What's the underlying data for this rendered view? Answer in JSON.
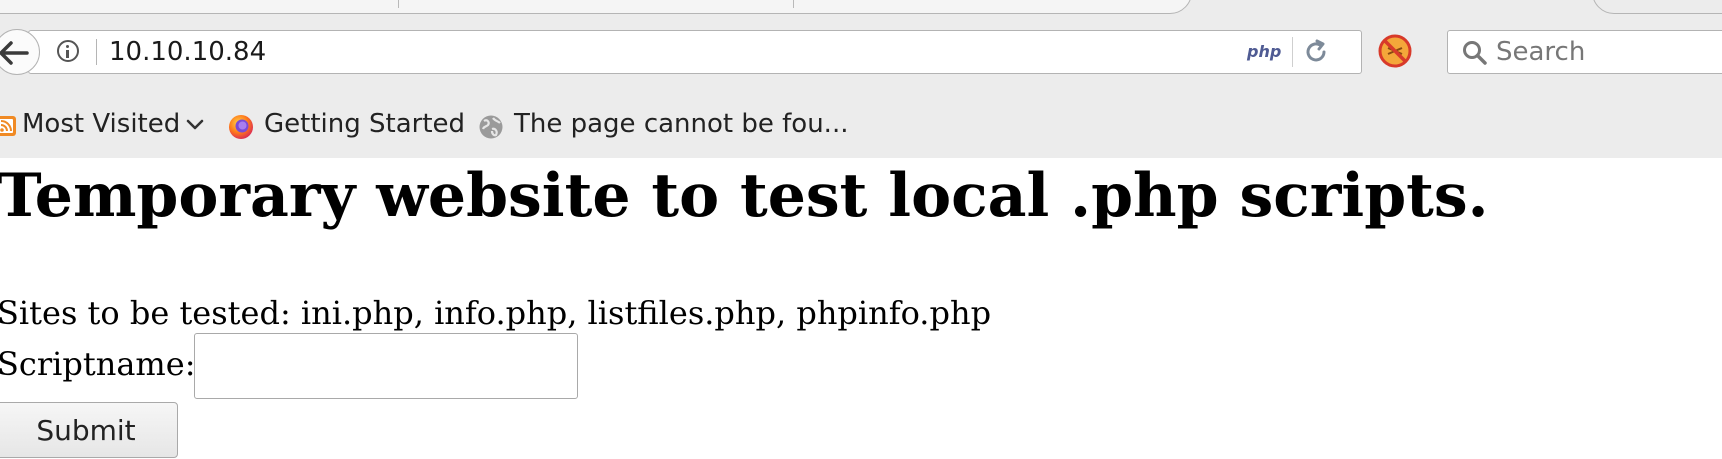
{
  "browser": {
    "url": "10.10.10.84",
    "url_badge": "php",
    "search_placeholder": "Search",
    "bookmarks": [
      {
        "label": "Most Visited",
        "icon": "rss-feed-icon"
      },
      {
        "label": "Getting Started",
        "icon": "firefox-icon"
      },
      {
        "label": "The page cannot be fou...",
        "icon": "globe-icon"
      }
    ]
  },
  "page": {
    "heading": "Temporary website to test local .php scripts.",
    "sites_text": "Sites to be tested: ini.php, info.php, listfiles.php, phpinfo.php",
    "scriptname_label": "Scriptname:",
    "scriptname_value": "",
    "submit_label": "Submit"
  },
  "colors": {
    "chrome_bg": "#ececec",
    "php_badge": "#4f5b93",
    "text": "#000000"
  }
}
